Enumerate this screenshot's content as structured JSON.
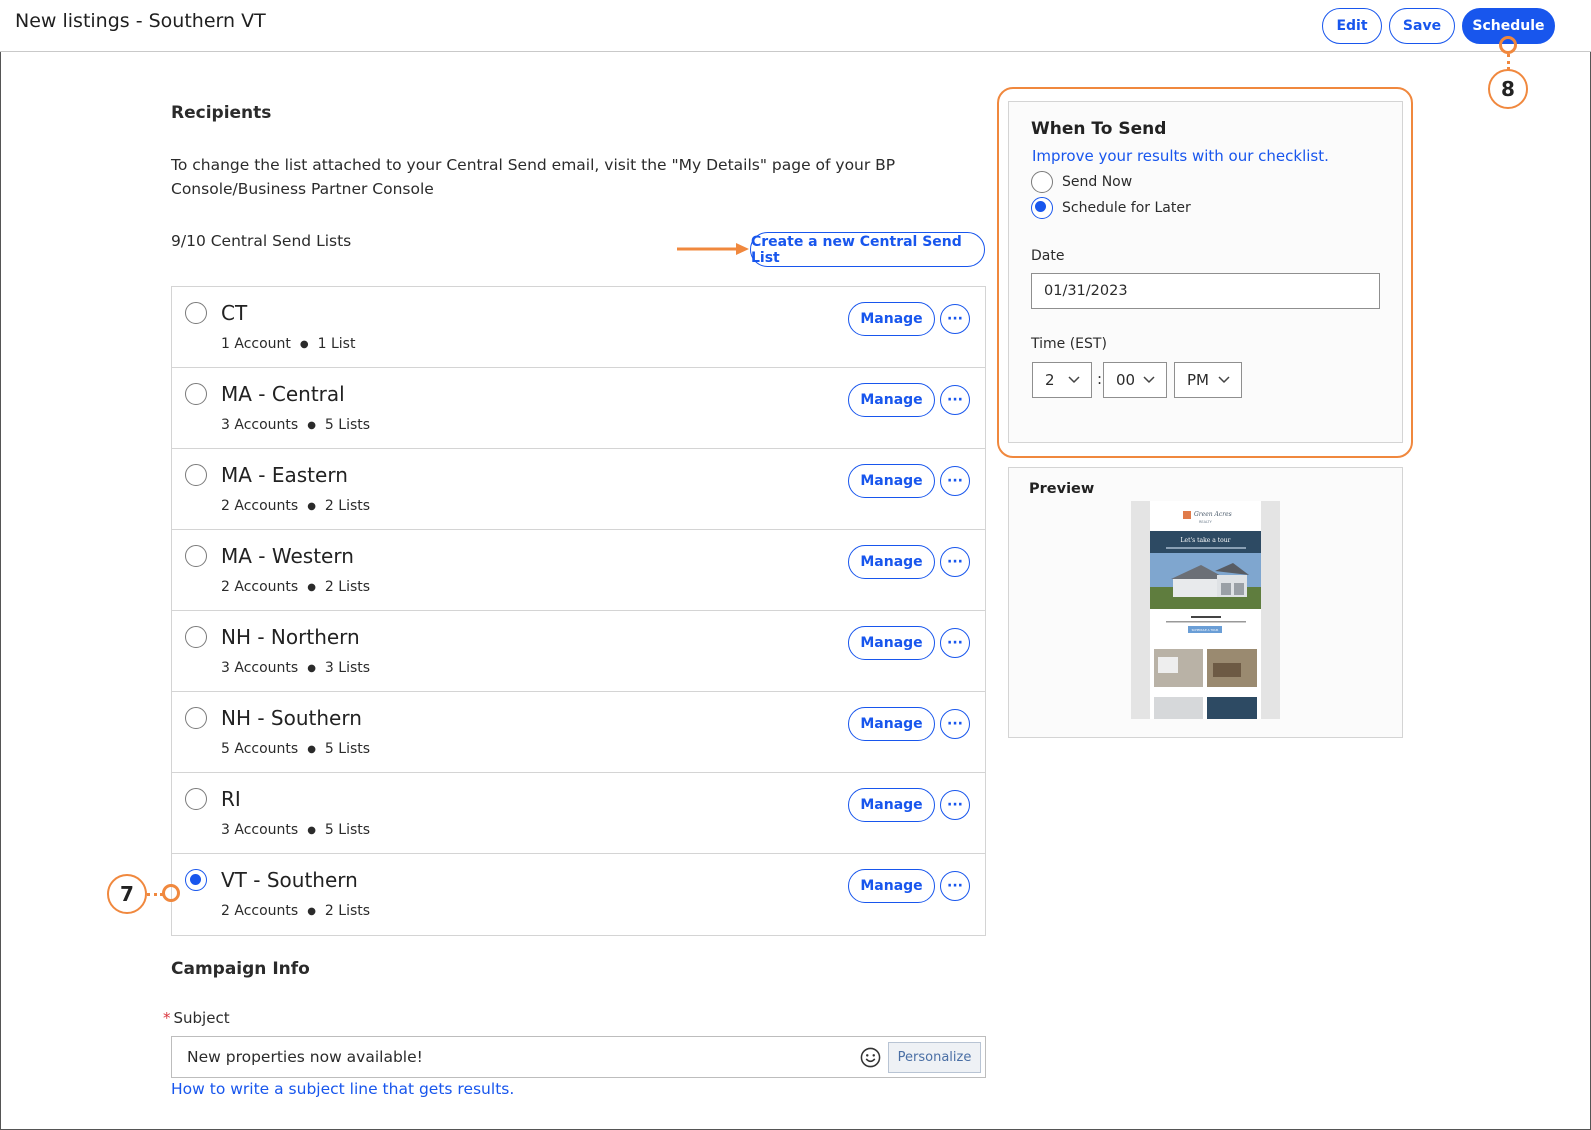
{
  "header": {
    "title": "New listings - Southern VT",
    "edit_label": "Edit",
    "save_label": "Save",
    "schedule_label": "Schedule"
  },
  "callouts": {
    "schedule_step": "8",
    "select_list_step": "7"
  },
  "recipients": {
    "title": "Recipients",
    "description": "To change the list attached to your Central Send email, visit the \"My Details\" page of your BP Console/Business Partner Console",
    "count": "9/10 Central Send Lists",
    "create_label": "Create a new Central Send List",
    "manage_label": "Manage",
    "lists": [
      {
        "name": "CT",
        "accounts": "1 Account",
        "lists": "1 List",
        "selected": false
      },
      {
        "name": "MA - Central",
        "accounts": "3 Accounts",
        "lists": "5 Lists",
        "selected": false
      },
      {
        "name": "MA - Eastern",
        "accounts": "2 Accounts",
        "lists": "2 Lists",
        "selected": false
      },
      {
        "name": "MA - Western",
        "accounts": "2 Accounts",
        "lists": "2 Lists",
        "selected": false
      },
      {
        "name": "NH - Northern",
        "accounts": "3 Accounts",
        "lists": "3 Lists",
        "selected": false
      },
      {
        "name": "NH - Southern",
        "accounts": "5 Accounts",
        "lists": "5 Lists",
        "selected": false
      },
      {
        "name": "RI",
        "accounts": "3 Accounts",
        "lists": "5 Lists",
        "selected": false
      },
      {
        "name": "VT - Southern",
        "accounts": "2 Accounts",
        "lists": "2 Lists",
        "selected": true
      }
    ]
  },
  "campaign": {
    "title": "Campaign Info",
    "subject_required": "*",
    "subject_label": "Subject",
    "subject_value": "New properties now available!",
    "personalize_label": "Personalize",
    "help_link": "How to write a subject line that gets results."
  },
  "when_to_send": {
    "title": "When To Send",
    "checklist_link": "Improve your results with our checklist.",
    "send_now_label": "Send Now",
    "schedule_later_label": "Schedule for Later",
    "selected_option": "schedule_later",
    "date_label": "Date",
    "date_value": "01/31/2023",
    "time_label": "Time (EST)",
    "hour": "2",
    "minute": "00",
    "ampm": "PM"
  },
  "preview": {
    "title": "Preview",
    "thumbnail_text": {
      "brand": "Green Acres",
      "brand_sub": "REALTY",
      "headline": "Let's take a tour",
      "button": "SCHEDULE A TOUR"
    }
  },
  "colors": {
    "accent": "#1856ed",
    "callout": "#f0883e",
    "border": "#d4d4d4"
  }
}
